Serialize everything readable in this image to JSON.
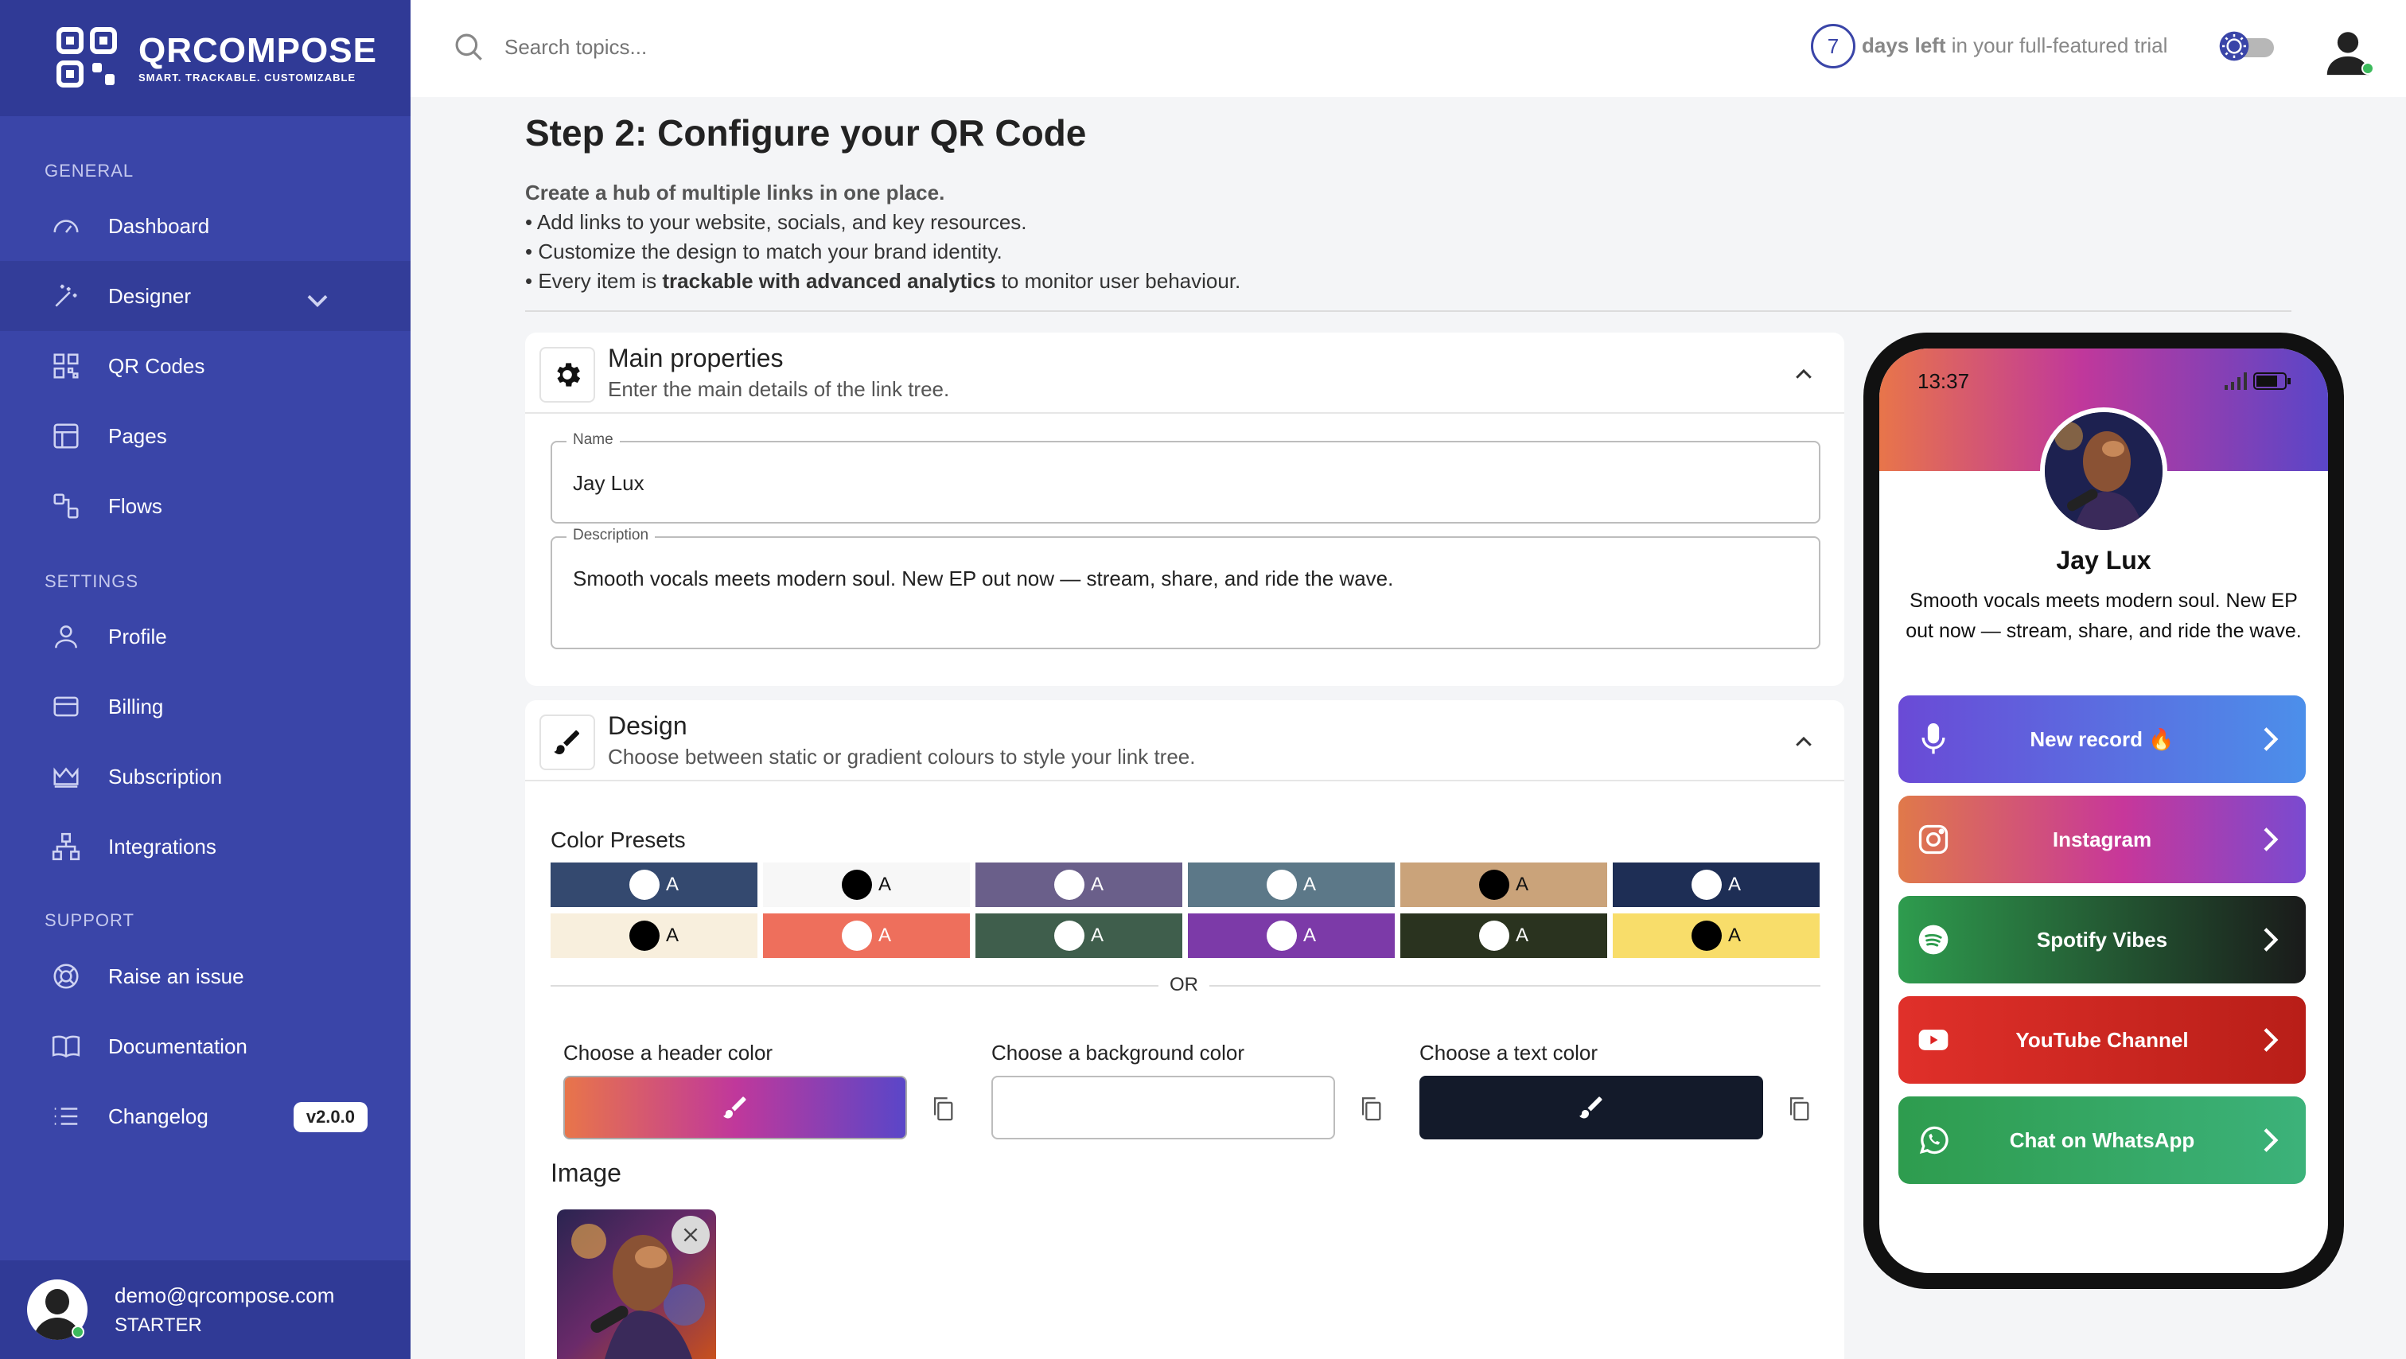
{
  "app": {
    "name": "QRCOMPOSE",
    "tagline": "SMART. TRACKABLE. CUSTOMIZABLE"
  },
  "sidebar": {
    "sections": {
      "general": "GENERAL",
      "settings": "SETTINGS",
      "support": "SUPPORT"
    },
    "items": [
      {
        "label": "Dashboard",
        "icon": "gauge-icon"
      },
      {
        "label": "Designer",
        "icon": "magic-wand-icon"
      },
      {
        "label": "QR Codes",
        "icon": "qr-icon"
      },
      {
        "label": "Pages",
        "icon": "layout-icon"
      },
      {
        "label": "Flows",
        "icon": "flow-icon"
      },
      {
        "label": "Profile",
        "icon": "user-icon"
      },
      {
        "label": "Billing",
        "icon": "credit-card-icon"
      },
      {
        "label": "Subscription",
        "icon": "crown-icon"
      },
      {
        "label": "Integrations",
        "icon": "hierarchy-icon"
      },
      {
        "label": "Raise an issue",
        "icon": "lifebuoy-icon"
      },
      {
        "label": "Documentation",
        "icon": "book-icon"
      },
      {
        "label": "Changelog",
        "icon": "list-icon",
        "badge": "v2.0.0"
      }
    ],
    "user": {
      "email": "demo@qrcompose.com",
      "plan": "STARTER"
    }
  },
  "topbar": {
    "search_placeholder": "Search topics...",
    "trial_days": "7",
    "trial_bold": "days left",
    "trial_rest": " in your full-featured trial"
  },
  "page": {
    "title": "Step 2: Configure your QR Code",
    "subtitle": "Create a hub of multiple links in one place.",
    "bullet1": "Add links to your website, socials, and key resources.",
    "bullet2": "Customize the design to match your brand identity.",
    "bullet3_pre": "Every item is ",
    "bullet3_bold": "trackable with advanced analytics",
    "bullet3_post": " to monitor user behaviour."
  },
  "main_props": {
    "title": "Main properties",
    "subtitle": "Enter the main details of the link tree.",
    "name_label": "Name",
    "name_value": "Jay Lux",
    "desc_label": "Description",
    "desc_value": "Smooth vocals meets modern soul. New EP out now — stream, share, and ride the wave."
  },
  "design": {
    "title": "Design",
    "subtitle": "Choose between static or gradient colours to style your link tree.",
    "presets_label": "Color Presets",
    "preset_letter": "A",
    "presets": [
      {
        "bg": "#34496f",
        "dot": "#ffffff",
        "fg": "#ffffff"
      },
      {
        "bg": "#f7f7f7",
        "dot": "#000000",
        "fg": "#111111"
      },
      {
        "bg": "#6a5f8a",
        "dot": "#ffffff",
        "fg": "#ffffff"
      },
      {
        "bg": "#5c7888",
        "dot": "#ffffff",
        "fg": "#ffffff"
      },
      {
        "bg": "#caa37a",
        "dot": "#000000",
        "fg": "#111111"
      },
      {
        "bg": "#1e2e55",
        "dot": "#ffffff",
        "fg": "#ffffff"
      },
      {
        "bg": "#f8efdd",
        "dot": "#000000",
        "fg": "#111111"
      },
      {
        "bg": "#ee6f5c",
        "dot": "#ffffff",
        "fg": "#ffffff"
      },
      {
        "bg": "#3f5e4c",
        "dot": "#ffffff",
        "fg": "#ffffff"
      },
      {
        "bg": "#7c3aa8",
        "dot": "#ffffff",
        "fg": "#ffffff"
      },
      {
        "bg": "#2a331f",
        "dot": "#ffffff",
        "fg": "#ffffff"
      },
      {
        "bg": "#f8dd6a",
        "dot": "#000000",
        "fg": "#111111"
      }
    ],
    "or_label": "OR",
    "header_color_label": "Choose a header color",
    "background_color_label": "Choose a background color",
    "text_color_label": "Choose a text color",
    "text_color": "#131a2a",
    "image_label": "Image"
  },
  "phone": {
    "time": "13:37",
    "name": "Jay Lux",
    "description": "Smooth vocals meets modern soul. New EP out now — stream, share, and ride the wave.",
    "links": [
      {
        "label": "New record 🔥",
        "icon": "microphone-icon"
      },
      {
        "label": "Instagram",
        "icon": "instagram-icon"
      },
      {
        "label": "Spotify Vibes",
        "icon": "spotify-icon"
      },
      {
        "label": "YouTube Channel",
        "icon": "youtube-icon"
      },
      {
        "label": "Chat on WhatsApp",
        "icon": "whatsapp-icon"
      }
    ]
  }
}
